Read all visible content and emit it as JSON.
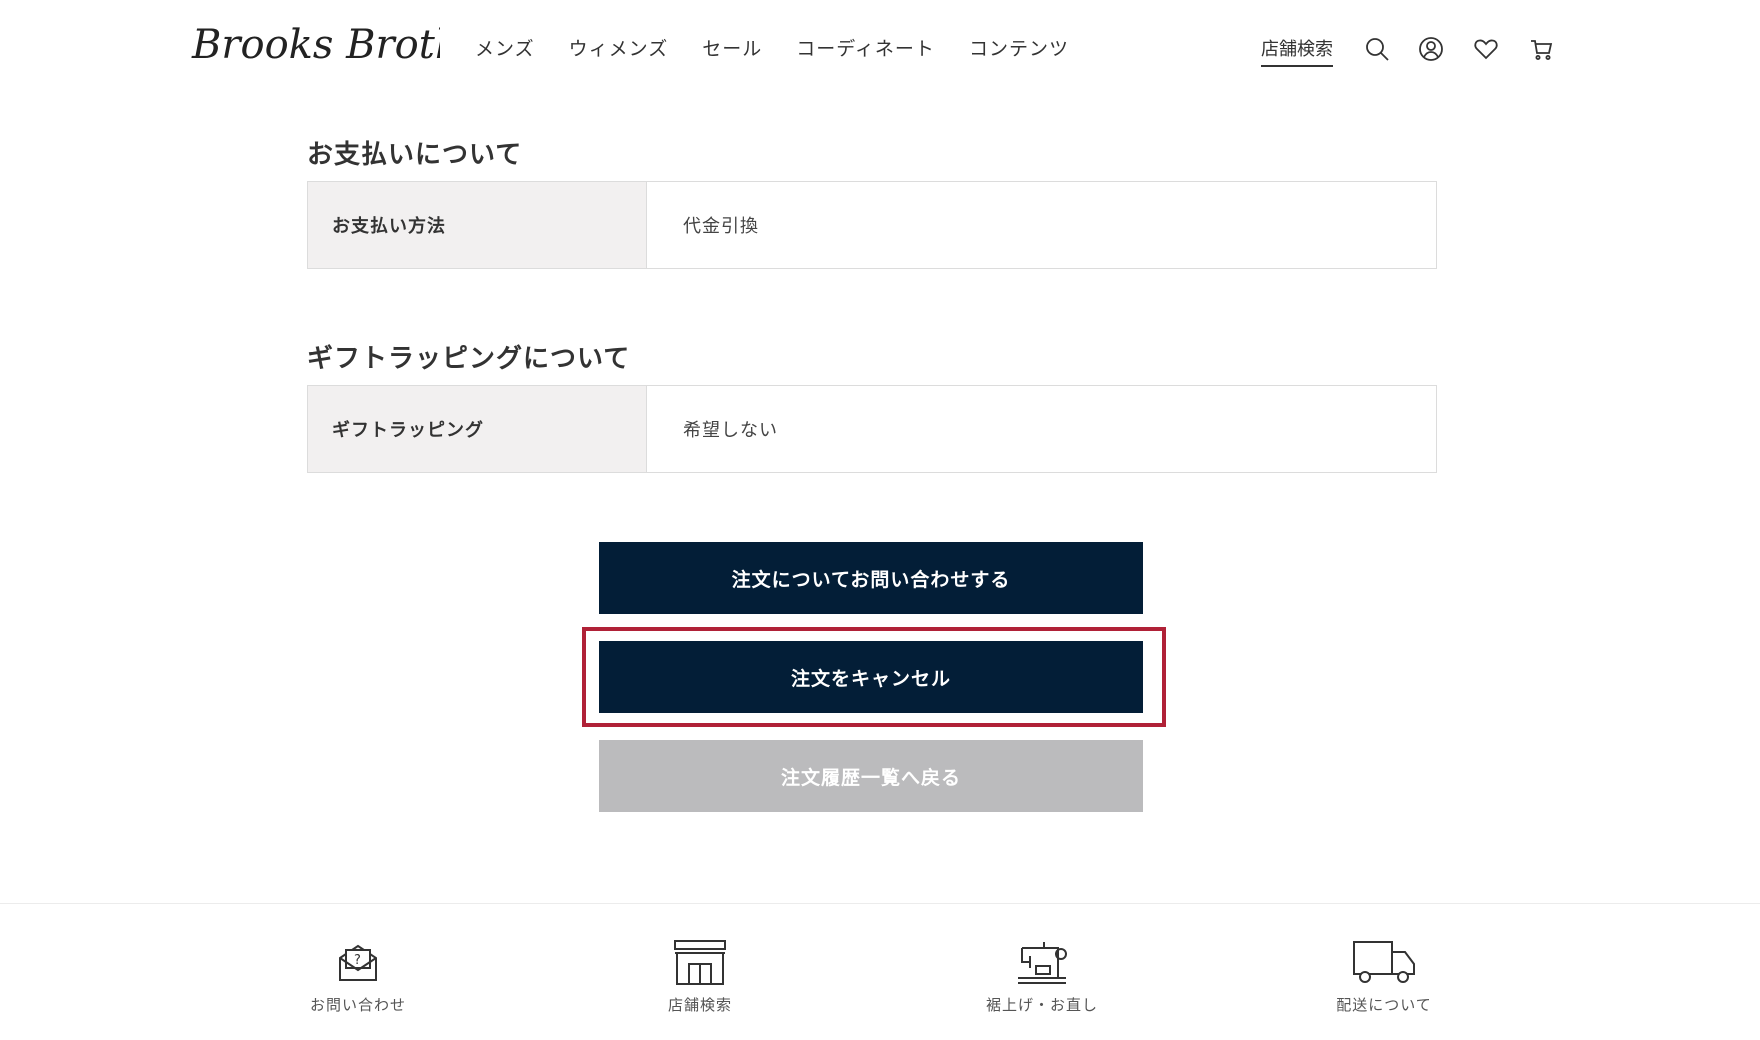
{
  "header": {
    "logo_text": "Brooks Brothers",
    "nav": [
      "メンズ",
      "ウィメンズ",
      "セール",
      "コーディネート",
      "コンテンツ"
    ],
    "store_search": "店舗検索",
    "icons": [
      "search-icon",
      "account-icon",
      "heart-icon",
      "cart-icon"
    ]
  },
  "payment": {
    "title": "お支払いについて",
    "label": "お支払い方法",
    "value": "代金引換"
  },
  "gift": {
    "title": "ギフトラッピングについて",
    "label": "ギフトラッピング",
    "value": "希望しない"
  },
  "buttons": {
    "contact": "注文についてお問い合わせする",
    "cancel": "注文をキャンセル",
    "back": "注文履歴一覧へ戻る"
  },
  "footer": {
    "items": [
      {
        "label": "お問い合わせ",
        "icon": "mail-question-icon"
      },
      {
        "label": "店舗検索",
        "icon": "store-icon"
      },
      {
        "label": "裾上げ・お直し",
        "icon": "sewing-machine-icon"
      },
      {
        "label": "配送について",
        "icon": "delivery-truck-icon"
      }
    ]
  },
  "colors": {
    "navy": "#031e37",
    "gray_button": "#bbbbbd",
    "highlight": "#b02137",
    "label_bg": "#f2f0f0"
  }
}
